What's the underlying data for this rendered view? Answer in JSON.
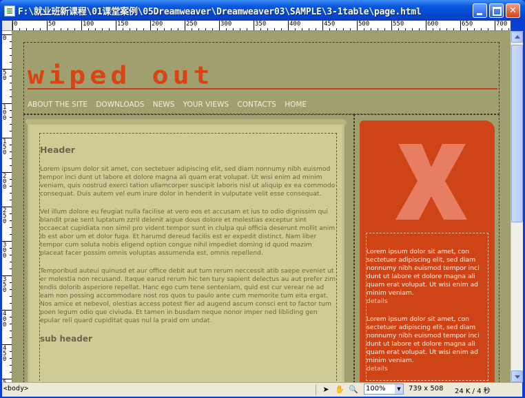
{
  "window": {
    "title": "F:\\就业班新课程\\01课堂案例\\05Dreamweaver\\Dreamweaver03\\SAMPLE\\3-1table\\page.html",
    "buttons": [
      "minimize",
      "maximize",
      "close"
    ]
  },
  "ruler": {
    "top_labels": [
      "0",
      "50",
      "100",
      "150",
      "200",
      "250",
      "300",
      "350",
      "400",
      "450",
      "500",
      "550",
      "600",
      "650",
      "700"
    ],
    "left_labels": [
      "0",
      "50",
      "100",
      "150",
      "200",
      "250",
      "300",
      "350",
      "400",
      "450",
      "500"
    ]
  },
  "page": {
    "logo": "wiped out",
    "nav": [
      "ABOUT THE SITE",
      "DOWNLOADS",
      "NEWS",
      "YOUR VIEWS",
      "CONTACTS",
      "HOME"
    ],
    "main": {
      "header": "Header",
      "paragraphs": [
        "Lorem ipsum dolor sit amet, con sectetuer adipiscing elit, sed diam nonnumy nibh euismod tempor inci dunt ut labore et dolore magna ali quam erat volupat. Ut wisi enim ad minim veniam, quis nostrud exerci tation ullamcorper suscipit laboris nisl ut aliquip ex ea commodo consequat. Duis autem vel eum irure dolor in henderit in vulputate velit esse consequat.",
        "Vel illum dolore eu feugiat nulla facilise at vero eos et accusam et ius to odio dignissim qui blandit prae sent luptatum zzril delenit aigue dous dolore et molestias exceptur sint occaecat cupidiata non simil pro vident tempor sunt in clulpa qui officia deserunt mollit anim ib est abor um et dolor fuga. Et harumd dereud facilis est er expedit distinct. Nam liber tempor cum soluta nobis eligend option congue nihil impediet doming id quod mazim placeat facer possim omnis voluptas assumenda est, omnis repellend.",
        "Temporibud auteui quinusd et aur office debit aut tum rerum neccessit atib saepe eveniet ut er molestia non recusand. Itaque earud rerum hic ten tury sapient delectus au aut prefer zim endis dolorib asperiore repellat. Hanc ego cum tene senteniam, quid est cur verear ne ad eam non possing accommodare nost ros quos tu paulo ante cum memorite tum eita ergat. Nos amice et nebevol, olestias access potest fier ad augend ascum consci ent to factor tum poen legum odio que civiuda. Et tamen in busdam neque nonor imper ned libliding gen epular reli quard cupiditat quas nul la praid om undat."
      ],
      "subheader": "sub header"
    },
    "sidebar": {
      "blocks": [
        {
          "text": "Lorem ipsum dolor sit amet, con sectetuer adipiscing elit, sed diam nonnumy nibh euismod tempor inci dunt ut labore et dolore magna ali quam erat volupat. Ut wisi enim ad minim veniam.",
          "link": "details"
        },
        {
          "text": "Lorem ipsum dolor sit amet, con sectetuer adipiscing elit, sed diam nonnumy nibh euismod tempor inci dunt ut labore et dolore magna ali quam erat volupat. Ut wisi enim ad minim veniam.",
          "link": "details"
        }
      ]
    }
  },
  "statusbar": {
    "tag": "<body>",
    "zoom": "100%",
    "dimensions": "739 x 508",
    "size": "24 K / 4 秒"
  },
  "colors": {
    "page_bg": "#a09f6f",
    "paper": "#cfcb96",
    "accent": "#d94411",
    "nav_text": "#f2f0d8"
  }
}
